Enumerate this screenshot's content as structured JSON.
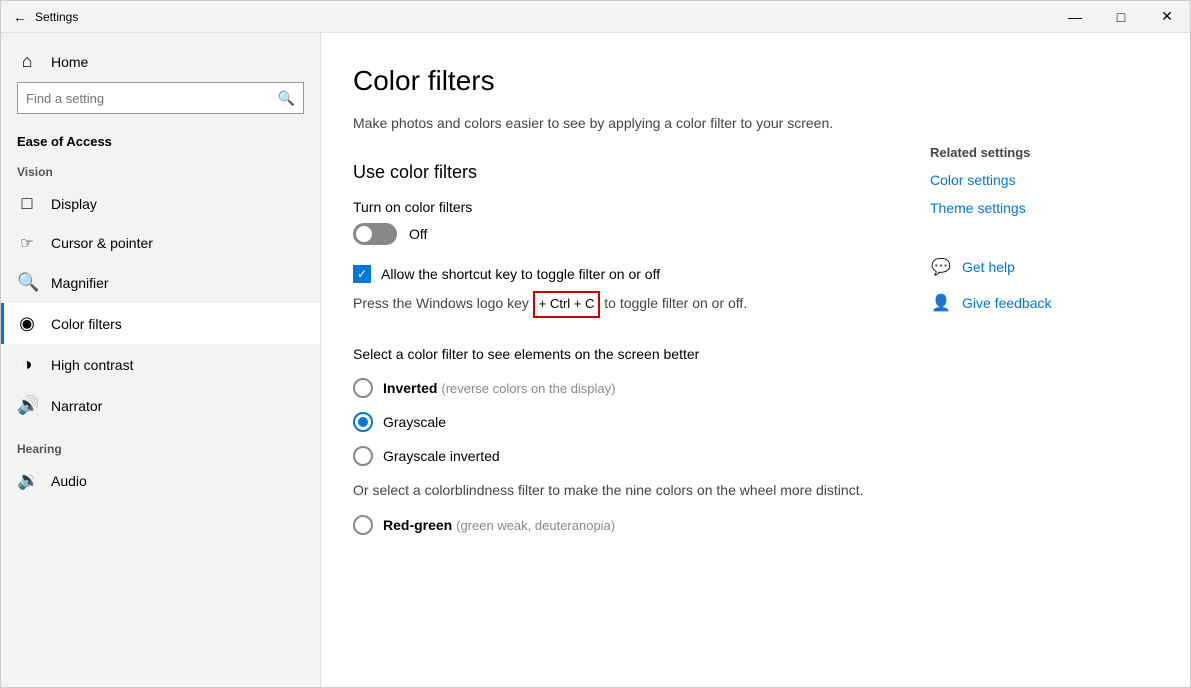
{
  "window": {
    "title": "Settings",
    "controls": {
      "minimize": "—",
      "maximize": "□",
      "close": "✕"
    }
  },
  "sidebar": {
    "back_label": "Back",
    "app_title": "Settings",
    "search": {
      "placeholder": "Find a setting",
      "icon": "🔍"
    },
    "nav": {
      "home_label": "Home",
      "sections": [
        {
          "label": "Vision",
          "items": [
            {
              "id": "display",
              "label": "Display",
              "icon": "🖥"
            },
            {
              "id": "cursor",
              "label": "Cursor & pointer",
              "icon": "🖱"
            },
            {
              "id": "magnifier",
              "label": "Magnifier",
              "icon": "🔍"
            },
            {
              "id": "color-filters",
              "label": "Color filters",
              "icon": "🎨",
              "active": true
            },
            {
              "id": "high-contrast",
              "label": "High contrast",
              "icon": "◑"
            },
            {
              "id": "narrator",
              "label": "Narrator",
              "icon": "🔊"
            }
          ]
        },
        {
          "label": "Hearing",
          "items": [
            {
              "id": "audio",
              "label": "Audio",
              "icon": "🔉"
            }
          ]
        }
      ]
    }
  },
  "main": {
    "title": "Color filters",
    "description": "Make photos and colors easier to see by applying a color filter to your screen.",
    "use_color_filters_section": "Use color filters",
    "toggle_label": "Turn on color filters",
    "toggle_state": "Off",
    "toggle_on": false,
    "checkbox_label": "Allow the shortcut key to toggle filter on or off",
    "checkbox_checked": true,
    "shortcut_text_before": "Press the Windows logo key",
    "shortcut_key": "+ Ctrl + C",
    "shortcut_text_after": "to toggle filter on or off.",
    "filter_select_label": "Select a color filter to see elements on the screen better",
    "filters": [
      {
        "id": "inverted",
        "label": "Inverted",
        "sublabel": "(reverse colors on the display)",
        "selected": false
      },
      {
        "id": "grayscale",
        "label": "Grayscale",
        "sublabel": "",
        "selected": true
      },
      {
        "id": "grayscale-inverted",
        "label": "Grayscale inverted",
        "sublabel": "",
        "selected": false
      }
    ],
    "colorblind_label": "Or select a colorblindness filter to make the nine colors on the wheel more distinct.",
    "colorblind_filters": [
      {
        "id": "red-green",
        "label": "Red-green",
        "sublabel": "(green weak, deuteranopia)",
        "selected": false
      }
    ]
  },
  "related": {
    "title": "Related settings",
    "links": [
      {
        "id": "color-settings",
        "label": "Color settings"
      },
      {
        "id": "theme-settings",
        "label": "Theme settings"
      }
    ]
  },
  "help": {
    "items": [
      {
        "id": "get-help",
        "label": "Get help",
        "icon": "💬"
      },
      {
        "id": "give-feedback",
        "label": "Give feedback",
        "icon": "👤"
      }
    ]
  }
}
